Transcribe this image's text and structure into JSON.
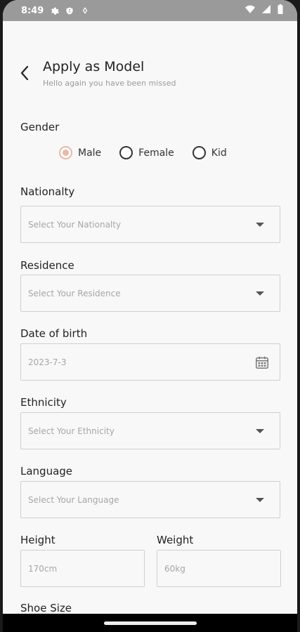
{
  "status_bar": {
    "time": "8:49"
  },
  "header": {
    "title": "Apply as Model",
    "subtitle": "Hello again you have been missed"
  },
  "gender": {
    "label": "Gender",
    "options": [
      "Male",
      "Female",
      "Kid"
    ],
    "selected": "Male"
  },
  "nationality": {
    "label": "Nationalty",
    "placeholder": "Select Your Nationalty"
  },
  "residence": {
    "label": "Residence",
    "placeholder": "Select Your Residence"
  },
  "dob": {
    "label": "Date of birth",
    "value": "2023-7-3"
  },
  "ethnicity": {
    "label": "Ethnicity",
    "placeholder": "Select Your Ethnicity"
  },
  "language": {
    "label": "Language",
    "placeholder": "Select Your Language"
  },
  "height": {
    "label": "Height",
    "placeholder": "170cm"
  },
  "weight": {
    "label": "Weight",
    "placeholder": "60kg"
  },
  "shoe_size": {
    "label": "Shoe Size"
  },
  "colors": {
    "accent": "#e8b9a5",
    "status_bar": "#9a9a9a"
  }
}
